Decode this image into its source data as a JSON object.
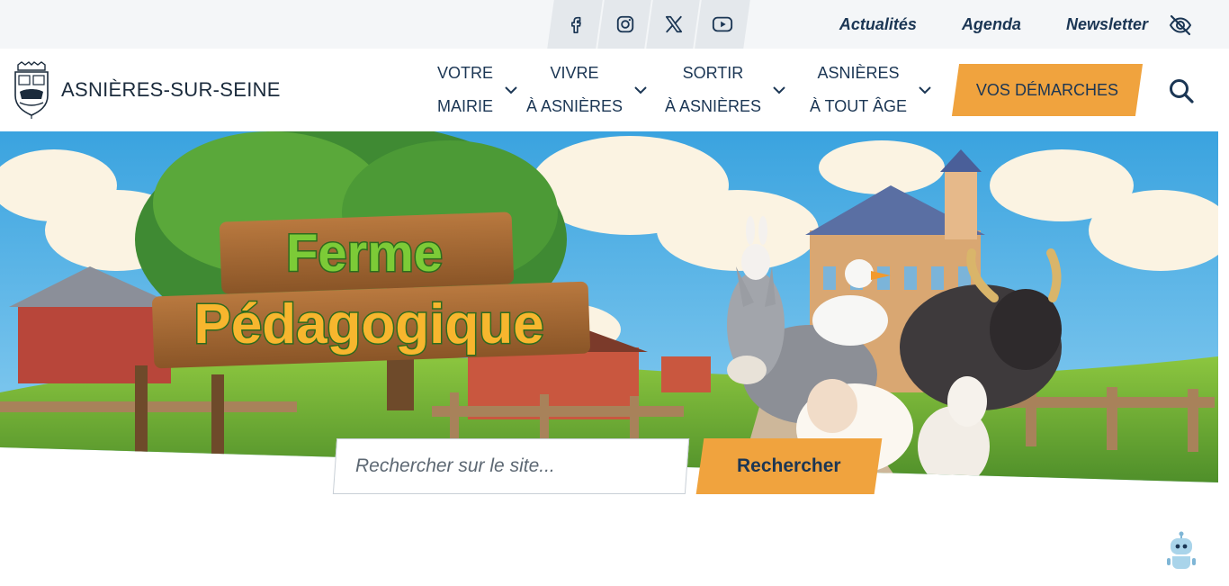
{
  "socials": [
    {
      "name": "facebook-icon"
    },
    {
      "name": "instagram-icon"
    },
    {
      "name": "x-twitter-icon"
    },
    {
      "name": "youtube-icon"
    }
  ],
  "toplinks": {
    "actualites": "Actualités",
    "agenda": "Agenda",
    "newsletter": "Newsletter"
  },
  "site": {
    "name": "ASNIÈRES-SUR-SEINE"
  },
  "nav": {
    "items": [
      {
        "line1": "VOTRE",
        "line2": "MAIRIE"
      },
      {
        "line1": "VIVRE",
        "line2": "À ASNIÈRES"
      },
      {
        "line1": "SORTIR",
        "line2": "À ASNIÈRES"
      },
      {
        "line1": "ASNIÈRES",
        "line2": "À TOUT ÂGE"
      }
    ],
    "demarches": "VOS DÉMARCHES"
  },
  "hero": {
    "title_line1": "Ferme",
    "title_line2": "Pédagogique"
  },
  "search": {
    "placeholder": "Rechercher sur le site...",
    "button": "Rechercher"
  },
  "colors": {
    "accent": "#f0a33e",
    "navy": "#1b3654",
    "topbar": "#f4f6f8"
  }
}
